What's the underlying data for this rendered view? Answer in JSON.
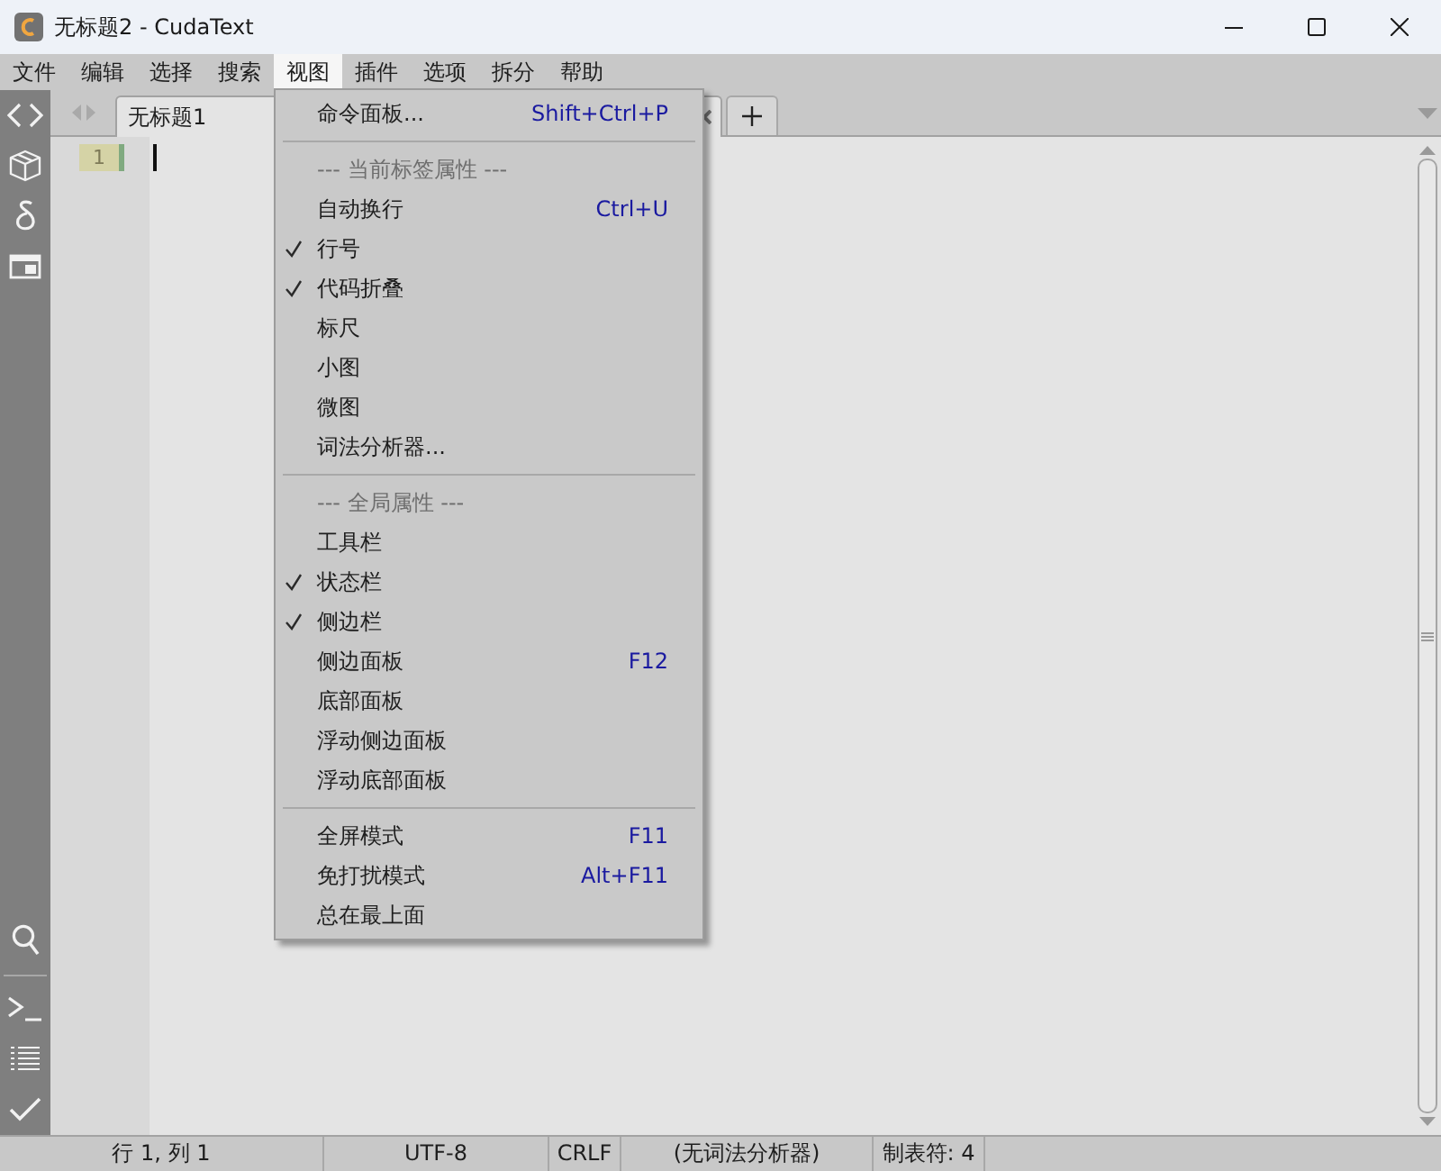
{
  "window": {
    "title": "无标题2 - CudaText"
  },
  "menu_bar": [
    {
      "label": "文件",
      "selected": false
    },
    {
      "label": "编辑",
      "selected": false
    },
    {
      "label": "选择",
      "selected": false
    },
    {
      "label": "搜索",
      "selected": false
    },
    {
      "label": "视图",
      "selected": true
    },
    {
      "label": "插件",
      "selected": false
    },
    {
      "label": "选项",
      "selected": false
    },
    {
      "label": "拆分",
      "selected": false
    },
    {
      "label": "帮助",
      "selected": false
    }
  ],
  "tabs": [
    {
      "label": "无标题1",
      "selected": true
    }
  ],
  "editor": {
    "line_numbers": [
      "1"
    ]
  },
  "view_menu": {
    "items": [
      {
        "kind": "item",
        "label": "命令面板...",
        "shortcut": "Shift+Ctrl+P",
        "checked": false
      },
      {
        "kind": "separator"
      },
      {
        "kind": "header",
        "label": "--- 当前标签属性 ---"
      },
      {
        "kind": "item",
        "label": "自动换行",
        "shortcut": "Ctrl+U",
        "checked": false
      },
      {
        "kind": "item",
        "label": "行号",
        "checked": true
      },
      {
        "kind": "item",
        "label": "代码折叠",
        "checked": true
      },
      {
        "kind": "item",
        "label": "标尺",
        "checked": false
      },
      {
        "kind": "item",
        "label": "小图",
        "checked": false
      },
      {
        "kind": "item",
        "label": "微图",
        "checked": false
      },
      {
        "kind": "item",
        "label": "词法分析器...",
        "checked": false
      },
      {
        "kind": "separator"
      },
      {
        "kind": "header",
        "label": "--- 全局属性 ---"
      },
      {
        "kind": "item",
        "label": "工具栏",
        "checked": false
      },
      {
        "kind": "item",
        "label": "状态栏",
        "checked": true
      },
      {
        "kind": "item",
        "label": "侧边栏",
        "checked": true
      },
      {
        "kind": "item",
        "label": "侧边面板",
        "shortcut": "F12",
        "checked": false
      },
      {
        "kind": "item",
        "label": "底部面板",
        "checked": false
      },
      {
        "kind": "item",
        "label": "浮动侧边面板",
        "checked": false
      },
      {
        "kind": "item",
        "label": "浮动底部面板",
        "checked": false
      },
      {
        "kind": "separator"
      },
      {
        "kind": "item",
        "label": "全屏模式",
        "shortcut": "F11",
        "checked": false
      },
      {
        "kind": "item",
        "label": "免打扰模式",
        "shortcut": "Alt+F11",
        "checked": false
      },
      {
        "kind": "item",
        "label": "总在最上面",
        "checked": false
      }
    ]
  },
  "status_bar": {
    "cells": [
      "行 1, 列 1",
      "UTF-8",
      "CRLF",
      "(无词法分析器)",
      "制表符: 4"
    ]
  }
}
